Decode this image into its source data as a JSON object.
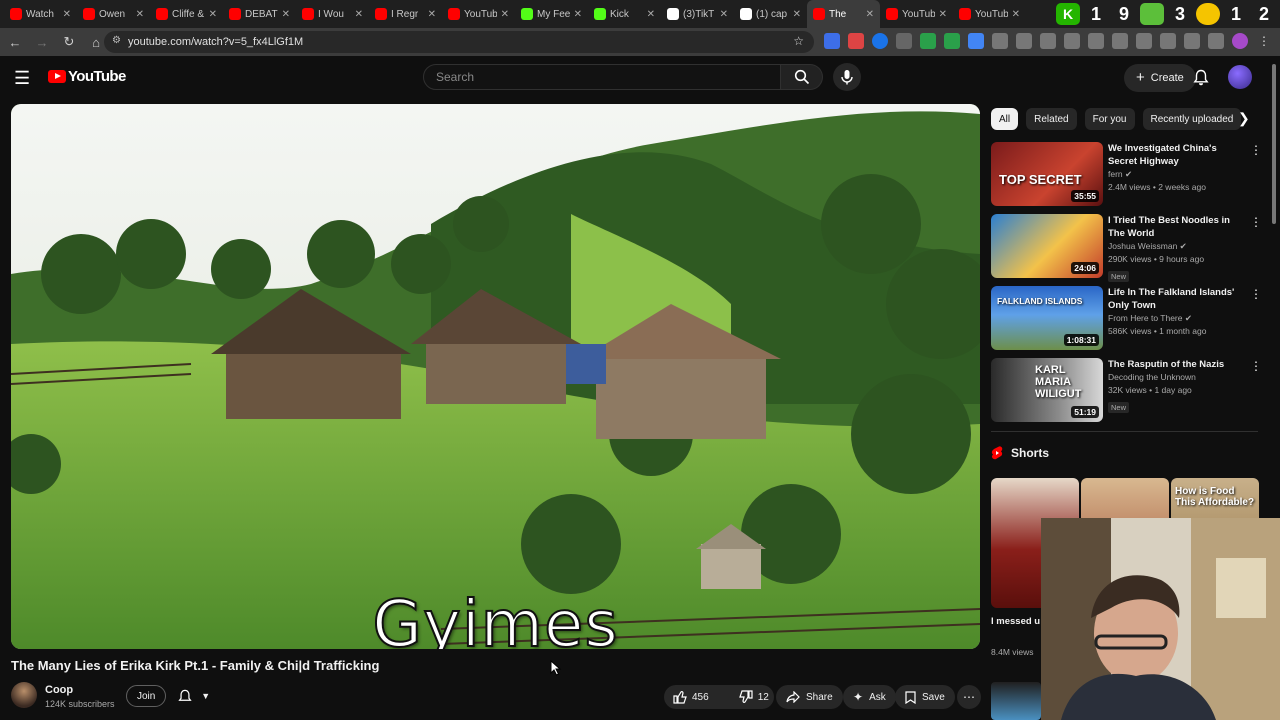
{
  "browser": {
    "tabs": [
      {
        "title": "Watch",
        "favicon_color": "#ff0000"
      },
      {
        "title": "Owen",
        "favicon_color": "#ff0000"
      },
      {
        "title": "Cliffe &",
        "favicon_color": "#ff0000"
      },
      {
        "title": "DEBATI",
        "favicon_color": "#ff0000"
      },
      {
        "title": "I Wou",
        "favicon_color": "#ff0000"
      },
      {
        "title": "I Regr",
        "favicon_color": "#ff0000"
      },
      {
        "title": "YouTub",
        "favicon_color": "#ff0000"
      },
      {
        "title": "My Fee",
        "favicon_color": "#53fc18"
      },
      {
        "title": "Kick",
        "favicon_color": "#53fc18"
      },
      {
        "title": "(3)TikT",
        "favicon_color": "#ffffff"
      },
      {
        "title": "(1) cap",
        "favicon_color": "#ffffff"
      },
      {
        "title": "The",
        "favicon_color": "#ff0000",
        "active": true
      },
      {
        "title": "YouTub",
        "favicon_color": "#ff0000"
      },
      {
        "title": "YouTub",
        "favicon_color": "#ff0000"
      }
    ],
    "tray_digits": [
      "1",
      "9",
      "3",
      "1",
      "2"
    ],
    "url": "youtube.com/watch?v=5_fx4LlGf1M"
  },
  "header": {
    "logo_text": "YouTube",
    "search_placeholder": "Search",
    "create_label": "Create"
  },
  "player": {
    "caption": "Gyimes"
  },
  "video": {
    "title": "The Many Lies of Erika Kirk Pt.1 - Family & Chi|d Trafficking",
    "channel": "Coop",
    "subscribers": "124K subscribers",
    "join_label": "Join",
    "likes": "456",
    "dislikes": "12",
    "share_label": "Share",
    "ask_label": "Ask",
    "save_label": "Save"
  },
  "chips": [
    "All",
    "Related",
    "For you",
    "Recently uploaded"
  ],
  "recommendations": [
    {
      "title": "We Investigated China's Secret Highway",
      "channel": "fern",
      "verified": true,
      "meta": "2.4M views • 2 weeks ago",
      "duration": "35:55",
      "thumb_text": "TOP SECRET",
      "is_new": false
    },
    {
      "title": "I Tried The Best Noodles in The World",
      "channel": "Joshua Weissman",
      "verified": true,
      "meta": "290K views • 9 hours ago",
      "duration": "24:06",
      "thumb_text": "",
      "is_new": true
    },
    {
      "title": "Life In The Falkland Islands' Only Town",
      "channel": "From Here to There",
      "verified": true,
      "meta": "586K views • 1 month ago",
      "duration": "1:08:31",
      "thumb_text": "FALKLAND ISLANDS",
      "is_new": false
    },
    {
      "title": "The Rasputin of the Nazis",
      "channel": "Decoding the Unknown",
      "verified": false,
      "meta": "32K views • 1 day ago",
      "duration": "51:19",
      "thumb_text": "KARL MARIA WILIGUT",
      "is_new": true
    }
  ],
  "new_label": "New",
  "shorts": {
    "heading": "Shorts",
    "first_title": "I messed u",
    "first_views": "8.4M views",
    "third_thumb_text": "How is Food This Affordable?"
  },
  "colors": {
    "background": "#0f0f0f",
    "youtube_red": "#ff0000",
    "chip_bg": "#272727"
  }
}
